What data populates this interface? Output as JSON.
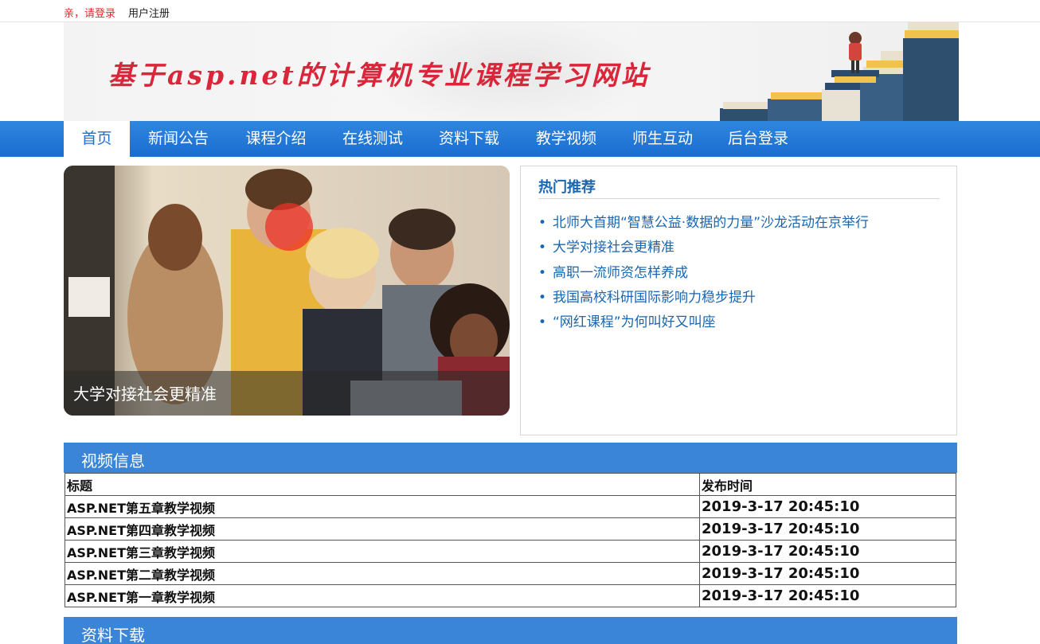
{
  "topbar": {
    "login_label": "亲，请登录",
    "register_label": "用户注册"
  },
  "banner": {
    "site_title": "基于asp.net的计算机专业课程学习网站"
  },
  "nav": {
    "items": [
      {
        "label": "首页",
        "active": true
      },
      {
        "label": "新闻公告"
      },
      {
        "label": "课程介绍"
      },
      {
        "label": "在线测试"
      },
      {
        "label": "资料下载"
      },
      {
        "label": "教学视频"
      },
      {
        "label": "师生互动"
      },
      {
        "label": "后台登录"
      }
    ]
  },
  "slider": {
    "caption": "大学对接社会更精准"
  },
  "hot": {
    "title": "热门推荐",
    "items": [
      "北师大首期“智慧公益·数据的力量”沙龙活动在京举行",
      "大学对接社会更精准",
      "高职一流师资怎样养成",
      "我国高校科研国际影响力稳步提升",
      "“网红课程”为何叫好又叫座"
    ]
  },
  "video_section": {
    "title": "视频信息",
    "columns": [
      "标题",
      "发布时间"
    ],
    "rows": [
      [
        "ASP.NET第五章教学视频",
        "2019-3-17 20:45:10"
      ],
      [
        "ASP.NET第四章教学视频",
        "2019-3-17 20:45:10"
      ],
      [
        "ASP.NET第三章教学视频",
        "2019-3-17 20:45:10"
      ],
      [
        "ASP.NET第二章教学视频",
        "2019-3-17 20:45:10"
      ],
      [
        "ASP.NET第一章教学视频",
        "2019-3-17 20:45:10"
      ]
    ]
  },
  "download_section": {
    "title": "资料下载"
  },
  "colors": {
    "nav_blue": "#1a6dd0",
    "section_blue": "#3a85d8",
    "link_blue": "#1a66b0",
    "title_red": "#d9263a"
  }
}
